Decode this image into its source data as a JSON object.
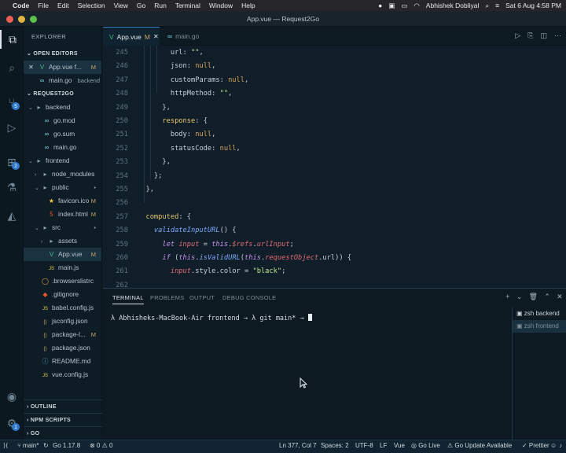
{
  "menubar": {
    "apple": "",
    "app_name": "Code",
    "menus": [
      "File",
      "Edit",
      "Selection",
      "View",
      "Go",
      "Run",
      "Terminal",
      "Window",
      "Help"
    ],
    "user": "Abhishek Dobliyal",
    "datetime": "Sat 6 Aug  4:58 PM"
  },
  "window": {
    "title": "App.vue — Request2Go"
  },
  "activity": {
    "scm_badge": "5",
    "ext_badge": "2",
    "settings_badge": "1"
  },
  "sidebar": {
    "title": "EXPLORER",
    "open_editors_label": "OPEN EDITORS",
    "open_editors": [
      {
        "name": "App.vue f...",
        "status": "M",
        "icon": "V",
        "close": "✕"
      },
      {
        "name": "main.go",
        "status": "backend",
        "icon": "∞"
      }
    ],
    "project_label": "REQUEST2GO",
    "tree": [
      {
        "name": "backend",
        "kind": "folder",
        "chev": "⌄"
      },
      {
        "name": "go.mod",
        "icon": "∞"
      },
      {
        "name": "go.sum",
        "icon": "∞"
      },
      {
        "name": "main.go",
        "icon": "∞"
      },
      {
        "name": "frontend",
        "kind": "folder",
        "chev": "⌄"
      },
      {
        "name": "node_modules",
        "kind": "folder",
        "chev": "›"
      },
      {
        "name": "public",
        "kind": "folder",
        "chev": "⌄",
        "status": "•"
      },
      {
        "name": "favicon.ico",
        "icon": "★",
        "status": "M"
      },
      {
        "name": "index.html",
        "icon": "5",
        "status": "M"
      },
      {
        "name": "src",
        "kind": "folder",
        "chev": "⌄",
        "status": "•"
      },
      {
        "name": "assets",
        "kind": "folder",
        "chev": "›"
      },
      {
        "name": "App.vue",
        "icon": "V",
        "status": "M"
      },
      {
        "name": "main.js",
        "icon": "JS"
      },
      {
        "name": ".browserslistrc",
        "icon": "◯"
      },
      {
        "name": ".gitignore",
        "icon": "◆"
      },
      {
        "name": "babel.config.js",
        "icon": "JS"
      },
      {
        "name": "jsconfig.json",
        "icon": "{}"
      },
      {
        "name": "package-l...",
        "icon": "{}",
        "status": "M"
      },
      {
        "name": "package.json",
        "icon": "{}"
      },
      {
        "name": "README.md",
        "icon": "ⓘ"
      },
      {
        "name": "vue.config.js",
        "icon": "JS"
      }
    ],
    "outline_label": "OUTLINE",
    "npm_label": "NPM SCRIPTS",
    "go_label": "GO"
  },
  "tabs": [
    {
      "label": "App.vue",
      "status": "M",
      "close": "✕",
      "icon": "V"
    },
    {
      "label": "main.go",
      "icon": "∞"
    }
  ],
  "editor": {
    "line_numbers": [
      "245",
      "246",
      "247",
      "248",
      "249",
      "250",
      "251",
      "252",
      "253",
      "254",
      "255",
      "256",
      "257",
      "258",
      "259",
      "260",
      "261",
      "262"
    ],
    "lines": [
      "        url: \"\",",
      "        json: null,",
      "        customParams: null,",
      "        httpMethod: \"\",",
      "      },",
      "      response: {",
      "        body: null,",
      "        statusCode: null,",
      "      },",
      "    };",
      "  },",
      "",
      "  computed: {",
      "    validateInputURL() {",
      "      let input = this.$refs.urlInput;",
      "      if (this.isValidURL(this.requestObject.url)) {",
      "        input.style.color = \"black\";",
      ""
    ]
  },
  "panel": {
    "tabs": [
      "TERMINAL",
      "PROBLEMS",
      "OUTPUT",
      "DEBUG CONSOLE"
    ],
    "prompt": "λ Abhisheks-MacBook-Air frontend → λ git main* → ",
    "terminals": [
      {
        "label": "zsh",
        "sub": "backend"
      },
      {
        "label": "zsh",
        "sub": "frontend"
      }
    ]
  },
  "status": {
    "branch": "main*",
    "go_version": "Go 1.17.8",
    "problems": "⊗ 0  ⚠ 0",
    "cursor": "Ln 377, Col 7",
    "spaces": "Spaces: 2",
    "encoding": "UTF-8",
    "eol": "LF",
    "language": "Vue",
    "golive": "Go Live",
    "go_update": "Go Update Available",
    "prettier": "✓ Prettier"
  },
  "colors": {
    "accent": "#3a86c8",
    "modified": "#c9a56b",
    "background": "#0f1e28"
  }
}
